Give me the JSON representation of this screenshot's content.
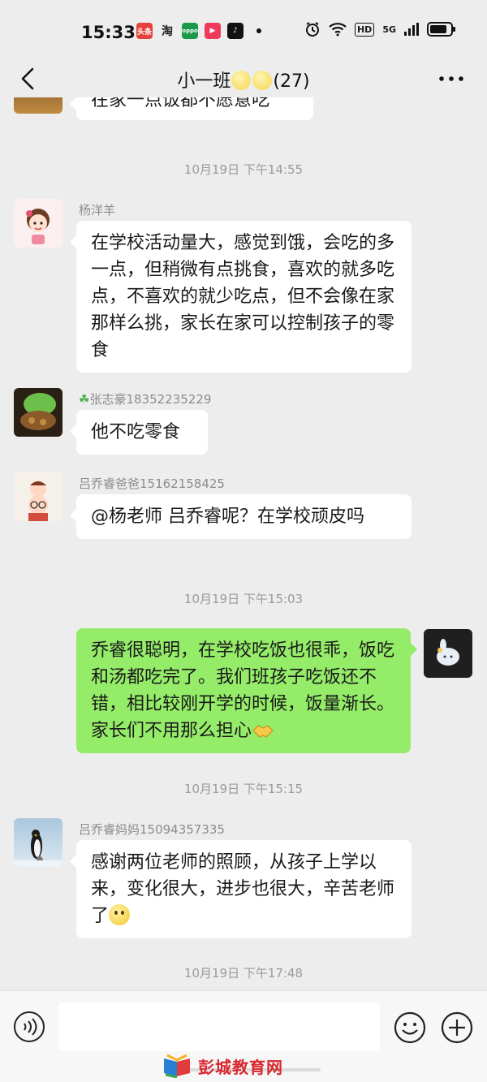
{
  "status_bar": {
    "time": "15:33",
    "apps": [
      {
        "name": "toutiao-icon",
        "label": "头条",
        "color": "#e8403b"
      },
      {
        "name": "taobao-icon",
        "label": "淘",
        "color": "#ff5000"
      },
      {
        "name": "oppo-icon",
        "label": "oppo",
        "color": "#1a9a4a"
      },
      {
        "name": "video-icon",
        "label": "▶",
        "color": "#ee3b5b"
      },
      {
        "name": "tiktok-icon",
        "label": "♪",
        "color": "#111111"
      }
    ],
    "hd_label": "HD",
    "signal_label": "5G"
  },
  "header": {
    "title_prefix": "小一班",
    "title_count": "(27)"
  },
  "messages": [
    {
      "text": "在家一点饭都不愿意吃"
    },
    {
      "timestamp": "10月19日 下午14:55"
    },
    {
      "sender": "杨洋羊",
      "text": "在学校活动量大，感觉到饿，会吃的多一点，但稍微有点挑食，喜欢的就多吃点，不喜欢的就少吃点，但不会像在家那样么挑，家长在家可以控制孩子的零食"
    },
    {
      "sender": "张志豪18352235229",
      "text": "他不吃零食"
    },
    {
      "sender": "吕乔睿爸爸15162158425",
      "text": "@杨老师  吕乔睿呢？在学校顽皮吗"
    },
    {
      "timestamp": "10月19日 下午15:03"
    },
    {
      "text": "乔睿很聪明，在学校吃饭也很乖，饭吃和汤都吃完了。我们班孩子吃饭还不错，相比较刚开学的时候，饭量渐长。家长们不用那么担心"
    },
    {
      "timestamp": "10月19日 下午15:15"
    },
    {
      "sender": "吕乔睿妈妈15094357335",
      "text": "感谢两位老师的照顾，从孩子上学以来，变化很大，进步也很大，辛苦老师了"
    },
    {
      "timestamp": "10月19日 下午17:48"
    }
  ],
  "input": {
    "placeholder": ""
  },
  "watermark": {
    "text": "彭城教育网"
  },
  "colors": {
    "background": "#ededed",
    "outgoing_bubble": "#95ec69",
    "incoming_bubble": "#ffffff"
  }
}
